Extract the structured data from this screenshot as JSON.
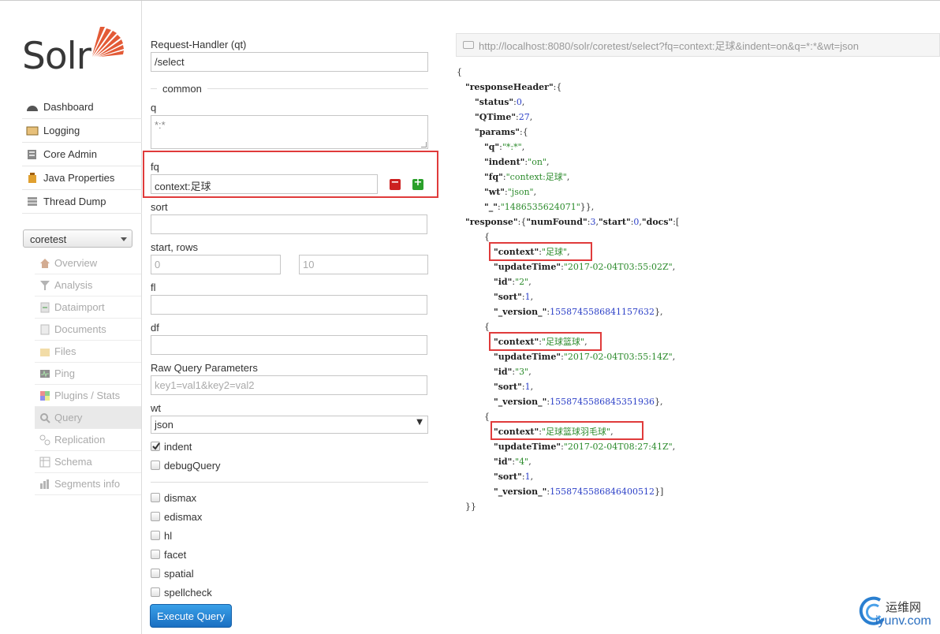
{
  "brand": {
    "logo_text": "Solr",
    "logo_color": "#e35a36"
  },
  "nav": [
    {
      "label": "Dashboard",
      "icon": "dashboard-icon"
    },
    {
      "label": "Logging",
      "icon": "logging-icon"
    },
    {
      "label": "Core Admin",
      "icon": "core-admin-icon"
    },
    {
      "label": "Java Properties",
      "icon": "java-icon"
    },
    {
      "label": "Thread Dump",
      "icon": "thread-dump-icon"
    }
  ],
  "core_selector": {
    "value": "coretest"
  },
  "core_nav": [
    {
      "label": "Overview",
      "icon": "home-icon"
    },
    {
      "label": "Analysis",
      "icon": "funnel-icon"
    },
    {
      "label": "Dataimport",
      "icon": "import-icon"
    },
    {
      "label": "Documents",
      "icon": "documents-icon"
    },
    {
      "label": "Files",
      "icon": "folder-icon"
    },
    {
      "label": "Ping",
      "icon": "ping-icon"
    },
    {
      "label": "Plugins / Stats",
      "icon": "plugins-icon"
    },
    {
      "label": "Query",
      "icon": "query-icon",
      "active": true
    },
    {
      "label": "Replication",
      "icon": "replication-icon"
    },
    {
      "label": "Schema",
      "icon": "schema-icon"
    },
    {
      "label": "Segments info",
      "icon": "segments-icon"
    }
  ],
  "form": {
    "request_handler_label": "Request-Handler (qt)",
    "request_handler_value": "/select",
    "common_label": "common",
    "q_label": "q",
    "q_value": "*:*",
    "fq_label": "fq",
    "fq_value": "context:足球",
    "sort_label": "sort",
    "start_rows_label": "start, rows",
    "start_placeholder": "0",
    "rows_placeholder": "10",
    "fl_label": "fl",
    "df_label": "df",
    "raw_label": "Raw Query Parameters",
    "raw_placeholder": "key1=val1&key2=val2",
    "wt_label": "wt",
    "wt_value": "json",
    "indent_label": "indent",
    "indent_checked": true,
    "debug_label": "debugQuery",
    "options": [
      "dismax",
      "edismax",
      "hl",
      "facet",
      "spatial",
      "spellcheck"
    ],
    "execute_label": "Execute Query"
  },
  "url": "http://localhost:8080/solr/coretest/select?fq=context:足球&indent=on&q=*:*&wt=json",
  "response": {
    "open": "{",
    "responseHeader_key": "\"responseHeader\"",
    "status_key": "\"status\"",
    "status_val": "0",
    "qtime_key": "\"QTime\"",
    "qtime_val": "27",
    "params_key": "\"params\"",
    "q_key": "\"q\"",
    "q_val": "\"*:*\"",
    "indent_key": "\"indent\"",
    "indent_val": "\"on\"",
    "fq_key": "\"fq\"",
    "fq_val": "\"context:足球\"",
    "wt_key": "\"wt\"",
    "wt_val": "\"json\"",
    "us_key": "\"_\"",
    "us_val": "\"1486535624071\"",
    "response_key": "\"response\"",
    "numfound_key": "\"numFound\"",
    "numfound_val": "3",
    "start_key": "\"start\"",
    "start_val": "0",
    "docs_key": "\"docs\"",
    "docs": [
      {
        "context": "\"足球\"",
        "updateTime": "\"2017-02-04T03:55:02Z\"",
        "id": "\"2\"",
        "sort": "1",
        "version": "1558745586841157632"
      },
      {
        "context": "\"足球篮球\"",
        "updateTime": "\"2017-02-04T03:55:14Z\"",
        "id": "\"3\"",
        "sort": "1",
        "version": "1558745586845351936"
      },
      {
        "context": "\"足球篮球羽毛球\"",
        "updateTime": "\"2017-02-04T08:27:41Z\"",
        "id": "\"4\"",
        "sort": "1",
        "version": "1558745586846400512"
      }
    ],
    "context_key": "\"context\"",
    "updatetime_key": "\"updateTime\"",
    "id_key": "\"id\"",
    "sort_key": "\"sort\"",
    "version_key": "\"_version_\"",
    "close": "}}"
  },
  "watermark": {
    "cn": "运维网",
    "en": "iyunv.com"
  }
}
